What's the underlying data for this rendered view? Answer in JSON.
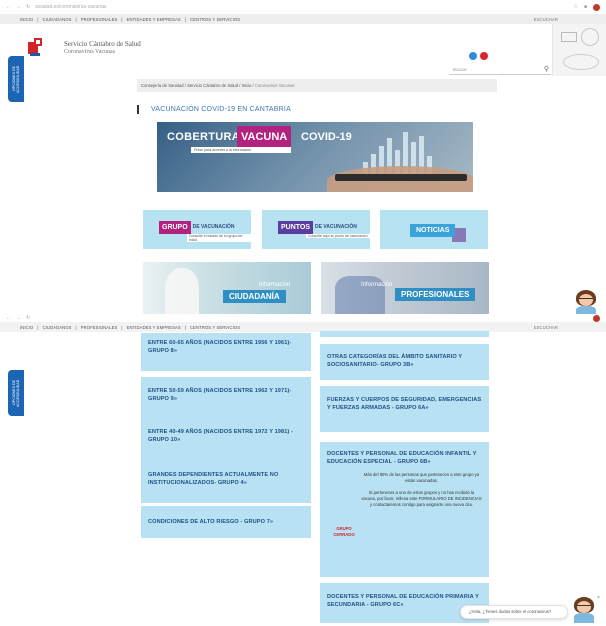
{
  "top": {
    "browser": {
      "url": "scsalud.es/coronavirus-vacunas"
    },
    "nav": {
      "items": [
        "INICIO",
        "CIUDADANOS",
        "PROFESIONALES",
        "ENTIDADES Y EMPRESAS",
        "CENTROS Y SERVICIOS"
      ],
      "right": "ESCUCHAR"
    },
    "brand": {
      "line1": "Servicio Cántabro de Salud",
      "line2": "Coronavirus Vacunas"
    },
    "search": {
      "placeholder": "Buscar"
    },
    "accessibility": {
      "label": "OPCIONES DE ACCESIBILIDAD"
    },
    "breadcrumb": {
      "items": [
        "Consejería de Sanidad",
        "Servicio Cántabro de Salud",
        "Inicio"
      ],
      "last": "Coronavirus Vacunas"
    },
    "section_title": "VACUNACIÓN  COVID-19 EN CANTABRIA",
    "banner": {
      "word1": "COBERTURA",
      "word2": "VACUNA",
      "word3": "COVID-19",
      "sub": "Pulse para acceder a la información"
    },
    "tiles": [
      {
        "highlight": "GRUPO",
        "rest": "DE VACUNACIÓN",
        "sub": "Consulte el estado de su grupo de edad"
      },
      {
        "highlight": "PUNTOS",
        "rest": "DE VACUNACIÓN",
        "sub": "Consulte aquí su punto de vacunación"
      },
      {
        "label": "NOTICIAS"
      }
    ],
    "photos": [
      {
        "small": "Información",
        "big": "CIUDADANÍA"
      },
      {
        "small": "Información",
        "big": "PROFESIONALES"
      }
    ]
  },
  "bottom": {
    "nav": {
      "items": [
        "INICIO",
        "CIUDADANOS",
        "PROFESIONALES",
        "ENTIDADES Y EMPRESAS",
        "CENTROS Y SERVICIOS"
      ],
      "right": "ESCUCHAR"
    },
    "accessibility": {
      "label": "OPCIONES DE ACCESIBILIDAD"
    },
    "left_cards": [
      "ENTRE 60-65 AÑOS (NACIDOS ENTRE 1956 Y 1961)- GRUPO 8»",
      "ENTRE 50-59 AÑOS (NACIDOS ENTRE 1962 Y 1971)- GRUPO 9»",
      "ENTRE 40-49 AÑOS (NACIDOS ENTRE 1972 Y 1981) - GRUPO 10»",
      "GRANDES DEPENDIENTES ACTUALMENTE NO INSTITUCIONALIZADOS- GRUPO 4»",
      "CONDICIONES DE ALTO RIESGO - GRUPO 7»"
    ],
    "right_cards": [
      "OTRAS CATEGORÍAS DEL ÁMBITO SANITARIO Y SOCIOSANITARIO- GRUPO 3B»",
      "FUERZAS Y CUERPOS DE SEGURIDAD, EMERGENCIAS Y FUERZAS ARMADAS - GRUPO 6A»",
      "DOCENTES Y PERSONAL DE EDUCACIÓN INFANTIL Y EDUCACIÓN ESPECIAL - GRUPO 6B»",
      "DOCENTES Y PERSONAL DE EDUCACIÓN PRIMARIA Y SECUNDARIA - GRUPO 6C»"
    ],
    "group6b_body": {
      "p1": "Más del 80% de las personas que pertenecen a este grupo ya están vacunadas.",
      "p2": "Si perteneces a uno de estos grupos y no has recibido la vacuna, por favor, rellena este FORMULARIO DE INCIDENCIAS y contactaremos contigo para asignarte una nueva cita.",
      "closed": "GRUPO CERRADO"
    },
    "chat": {
      "text": "¿Hola, ¿Tienes dudas sobre el coronavirus?"
    }
  },
  "colors": {
    "brand_red": "#d2232a",
    "tile_blue": "#b8e2f3",
    "title_blue": "#1f4e86",
    "magenta": "#b22380"
  }
}
